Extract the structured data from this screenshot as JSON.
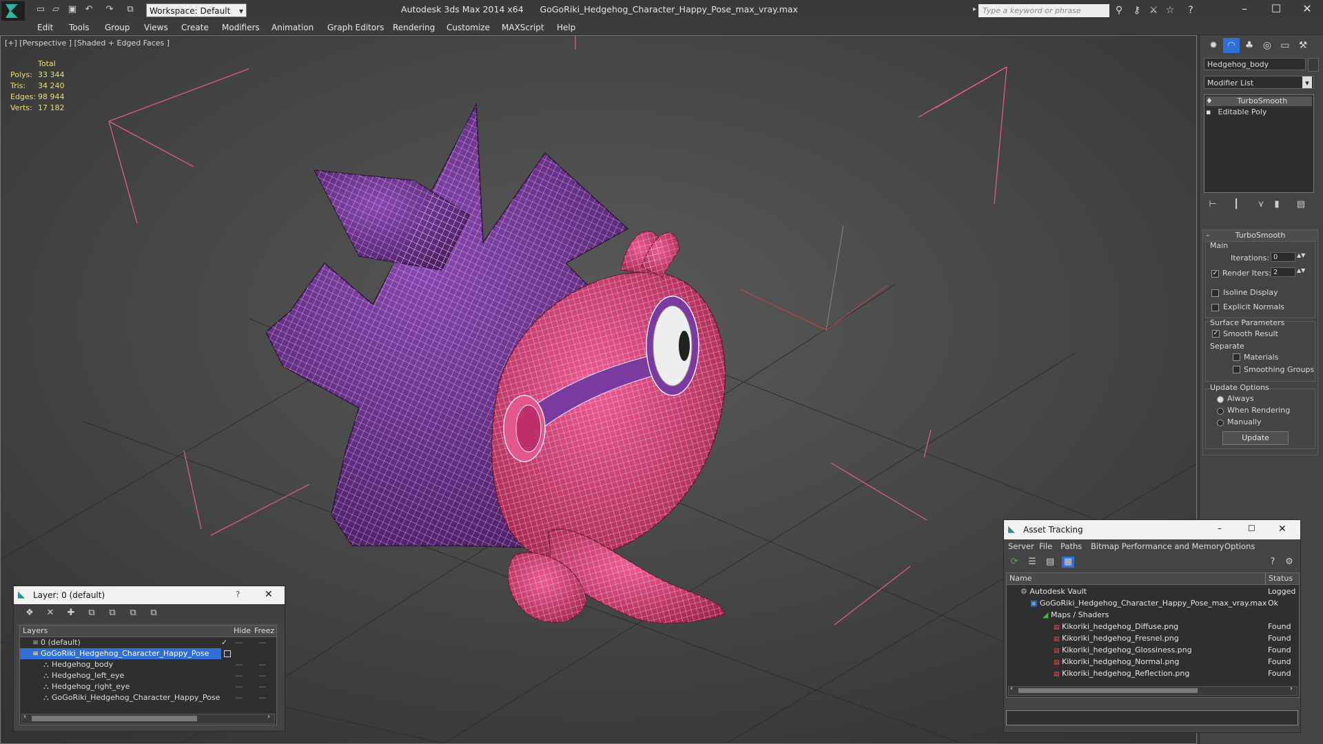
{
  "titlebar": {
    "workspace": "Workspace: Default",
    "app_title": "Autodesk 3ds Max  2014 x64",
    "file_title": "GoGoRiki_Hedgehog_Character_Happy_Pose_max_vray.max",
    "search_placeholder": "Type a keyword or phrase"
  },
  "menubar": [
    "Edit",
    "Tools",
    "Group",
    "Views",
    "Create",
    "Modifiers",
    "Animation",
    "Graph Editors",
    "Rendering",
    "Customize",
    "MAXScript",
    "Help"
  ],
  "viewport": {
    "label": "[+] [Perspective ] [Shaded + Edged Faces ]",
    "stats": {
      "header": "Total",
      "rows": [
        {
          "label": "Polys:",
          "value": "33 344"
        },
        {
          "label": "Tris:",
          "value": "34 240"
        },
        {
          "label": "Edges:",
          "value": "98 944"
        },
        {
          "label": "Verts:",
          "value": "17 182"
        }
      ]
    }
  },
  "command_panel": {
    "object_name": "Hedgehog_body",
    "modifier_list": "Modifier List",
    "stack": [
      "TurboSmooth",
      "Editable Poly"
    ],
    "turbosmooth": {
      "title": "TurboSmooth",
      "main": "Main",
      "iterations_label": "Iterations:",
      "iterations": "0",
      "render_iters_label": "Render Iters:",
      "render_iters": "2",
      "isoline": "Isoline Display",
      "explicit_normals": "Explicit Normals",
      "surface_params": "Surface Parameters",
      "smooth_result": "Smooth Result",
      "separate": "Separate",
      "materials": "Materials",
      "smoothing_groups": "Smoothing Groups",
      "update_options": "Update Options",
      "always": "Always",
      "when_rendering": "When Rendering",
      "manually": "Manually",
      "update_button": "Update"
    }
  },
  "layer_window": {
    "title": "Layer: 0 (default)",
    "headers": {
      "layers": "Layers",
      "hide": "Hide",
      "freeze": "Freez"
    },
    "rows": [
      {
        "name": "0 (default)",
        "indent": 0
      },
      {
        "name": "GoGoRiki_Hedgehog_Character_Happy_Pose",
        "indent": 0
      },
      {
        "name": "Hedgehog_body",
        "indent": 1
      },
      {
        "name": "Hedgehog_left_eye",
        "indent": 1
      },
      {
        "name": "Hedgehog_right_eye",
        "indent": 1
      },
      {
        "name": "GoGoRiki_Hedgehog_Character_Happy_Pose",
        "indent": 1
      }
    ]
  },
  "asset_window": {
    "title": "Asset Tracking",
    "menu": [
      "Server",
      "File",
      "Paths",
      "Bitmap Performance and Memory",
      "Options"
    ],
    "col_name": "Name",
    "col_status": "Status",
    "rows": [
      {
        "name": "Autodesk Vault",
        "status": "Logged"
      },
      {
        "name": "GoGoRiki_Hedgehog_Character_Happy_Pose_max_vray.max",
        "status": "Ok"
      },
      {
        "name": "Maps / Shaders",
        "status": ""
      },
      {
        "name": "Kikoriki_hedgehog_Diffuse.png",
        "status": "Found"
      },
      {
        "name": "Kikoriki_hedgehog_Fresnel.png",
        "status": "Found"
      },
      {
        "name": "Kikoriki_hedgehog_Glossiness.png",
        "status": "Found"
      },
      {
        "name": "Kikoriki_hedgehog_Normal.png",
        "status": "Found"
      },
      {
        "name": "Kikoriki_hedgehog_Reflection.png",
        "status": "Found"
      }
    ]
  },
  "colors": {
    "spike_purple": "#6e2f8c",
    "body_pink": "#d83a78",
    "selection_blue": "#2f6fd6",
    "stats_yellow": "#e8e070"
  }
}
